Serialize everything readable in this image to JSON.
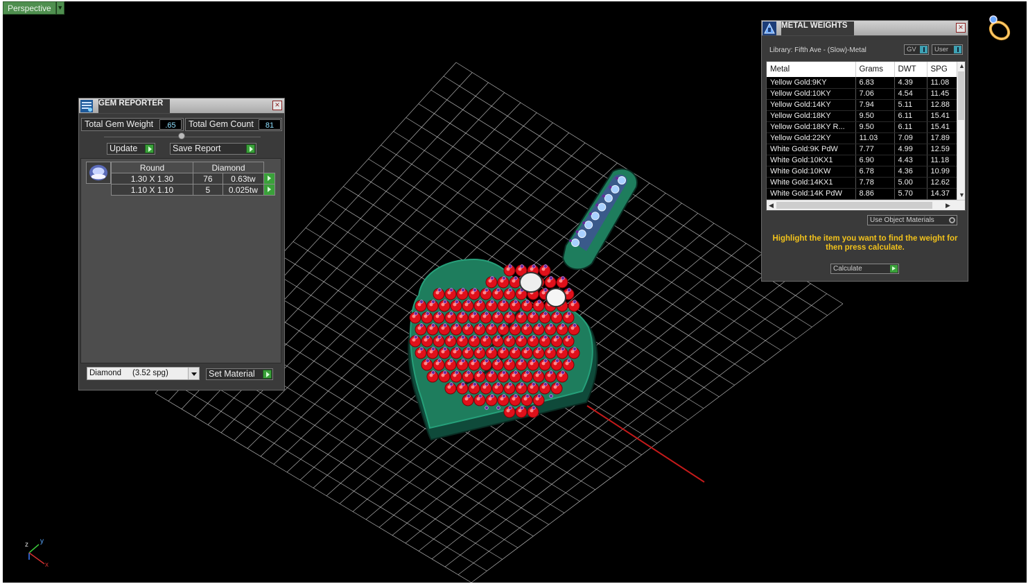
{
  "viewport": {
    "label": "Perspective",
    "axis": {
      "x": "x",
      "y": "y",
      "z": "z"
    },
    "colors": {
      "background": "#000000",
      "grid": "#cfcfcf",
      "metal": "#1e7d5d",
      "ruby": "#e0101a",
      "prong": "#6a2a9a",
      "bail_stone": "#a8d0ff",
      "x_axis": "#c41a1a"
    }
  },
  "gem_reporter": {
    "title": "GEM REPORTER",
    "total_weight_label": "Total Gem Weight",
    "total_weight_value": ".65",
    "total_count_label": "Total Gem Count",
    "total_count_value": "81",
    "update_label": "Update",
    "save_report_label": "Save Report",
    "table": {
      "shape": "Round",
      "material": "Diamond",
      "rows": [
        {
          "size": "1.30 X 1.30",
          "count": "76",
          "weight": "0.63tw"
        },
        {
          "size": "1.10 X 1.10",
          "count": "5",
          "weight": "0.025tw"
        }
      ]
    },
    "material_select": "Diamond     (3.52 spg)",
    "set_material_label": "Set Material"
  },
  "metal_weights": {
    "title": "METAL WEIGHTS",
    "library": "Library: Fifth Ave - (Slow)-Metal",
    "toggle_gv": "GV",
    "toggle_user": "User",
    "columns": [
      "Metal",
      "Grams",
      "DWT",
      "SPG"
    ],
    "rows": [
      [
        "Yellow Gold:9KY",
        "6.83",
        "4.39",
        "11.08"
      ],
      [
        "Yellow Gold:10KY",
        "7.06",
        "4.54",
        "11.45"
      ],
      [
        "Yellow Gold:14KY",
        "7.94",
        "5.11",
        "12.88"
      ],
      [
        "Yellow Gold:18KY",
        "9.50",
        "6.11",
        "15.41"
      ],
      [
        "Yellow Gold:18KY R...",
        "9.50",
        "6.11",
        "15.41"
      ],
      [
        "Yellow Gold:22KY",
        "11.03",
        "7.09",
        "17.89"
      ],
      [
        "White Gold:9K PdW",
        "7.77",
        "4.99",
        "12.59"
      ],
      [
        "White Gold:10KX1",
        "6.90",
        "4.43",
        "11.18"
      ],
      [
        "White Gold:10KW",
        "6.78",
        "4.36",
        "10.99"
      ],
      [
        "White Gold:14KX1",
        "7.78",
        "5.00",
        "12.62"
      ],
      [
        "White Gold:14K PdW",
        "8.86",
        "5.70",
        "14.37"
      ]
    ],
    "use_object_materials": "Use Object Materials",
    "hint": "Highlight the item you want to find the weight for then press calculate.",
    "calculate_label": "Calculate"
  }
}
